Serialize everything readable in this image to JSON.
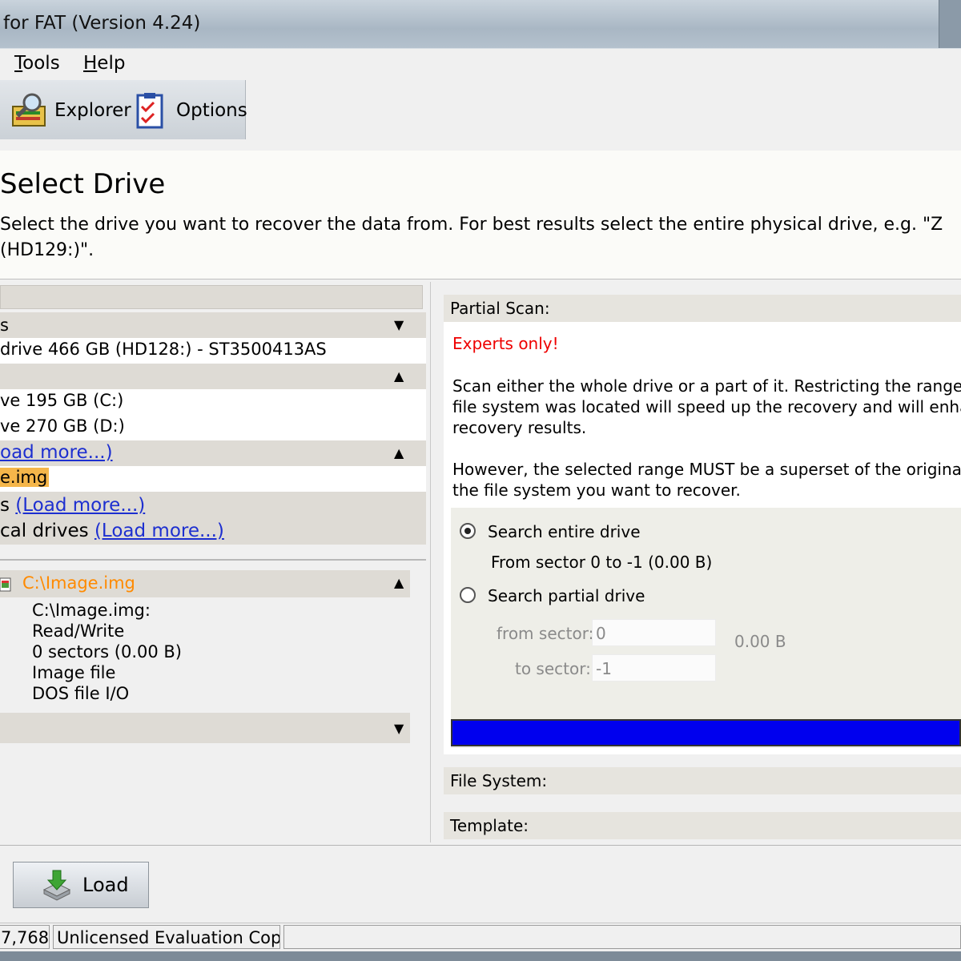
{
  "window": {
    "title": "for FAT (Version 4.24)"
  },
  "menu": {
    "tools": "Tools",
    "help": "Help"
  },
  "toolbar": {
    "explorer": "Explorer",
    "options": "Options"
  },
  "header": {
    "title": "Select Drive",
    "desc_line1": "Select the drive you want to recover the data from. For best results select the entire physical drive, e.g. \"Z",
    "desc_line2": "(HD129:)\"."
  },
  "drives": {
    "group1_label": "s",
    "hd128": "drive 466 GB (HD128:) - ST3500413AS",
    "c_drive": "ve 195 GB (C:)",
    "d_drive": "ve 270 GB (D:)",
    "load_more_images": "oad more...)",
    "image_item": "e.img",
    "group4_prefix": "s",
    "group4_link": "(Load more...)",
    "group5_prefix": "cal drives",
    "group5_link": "(Load more...)"
  },
  "details": {
    "name": "C:\\Image.img",
    "lines": [
      "C:\\Image.img:",
      "Read/Write",
      "0 sectors (0.00 B)",
      "Image file",
      "DOS file I/O"
    ]
  },
  "partial_scan": {
    "header": "Partial Scan:",
    "warning": "Experts only!",
    "para1": [
      "Scan either the whole drive or a part of it. Restricting the range to th",
      "file system was located will speed up the recovery and will enhance",
      "recovery results."
    ],
    "para2": [
      "However, the selected range MUST be a superset of the original loc",
      "the file system you want to recover."
    ],
    "option_entire": "Search entire drive",
    "entire_range": "From sector 0 to -1 (0.00 B)",
    "option_partial": "Search partial drive",
    "from_label": "from sector:",
    "from_value": "0",
    "to_label": "to sector:",
    "to_value": "-1",
    "size_label": "0.00 B",
    "progress": 1.0
  },
  "file_system": {
    "header": "File System:"
  },
  "template": {
    "header": "Template:"
  },
  "buttons": {
    "load": "Load"
  },
  "status": {
    "cell1": "7,768",
    "cell2": "Unlicensed Evaluation Copy"
  },
  "colors": {
    "progress": "#0000ee",
    "warning": "#ee0000",
    "link": "#1d2fd0",
    "selected_name": "#ff8a00"
  }
}
